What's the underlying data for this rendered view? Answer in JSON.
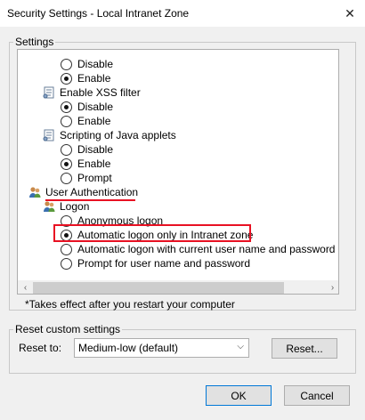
{
  "window": {
    "title": "Security Settings - Local Intranet Zone"
  },
  "settings_group": {
    "legend": "Settings"
  },
  "tree": [
    {
      "kind": "radio",
      "label": "Disable",
      "checked": false
    },
    {
      "kind": "radio",
      "label": "Enable",
      "checked": true
    },
    {
      "kind": "category",
      "label": "Enable XSS filter",
      "icon": "settings-page-icon"
    },
    {
      "kind": "radio",
      "label": "Disable",
      "checked": true
    },
    {
      "kind": "radio",
      "label": "Enable",
      "checked": false
    },
    {
      "kind": "category",
      "label": "Scripting of Java applets",
      "icon": "settings-page-icon"
    },
    {
      "kind": "radio",
      "label": "Disable",
      "checked": false
    },
    {
      "kind": "radio",
      "label": "Enable",
      "checked": true
    },
    {
      "kind": "radio",
      "label": "Prompt",
      "checked": false
    },
    {
      "kind": "category",
      "label": "User Authentication",
      "icon": "users-icon"
    },
    {
      "kind": "category",
      "label": "Logon",
      "icon": "users-icon"
    },
    {
      "kind": "radio",
      "label": "Anonymous logon",
      "checked": false
    },
    {
      "kind": "radio",
      "label": "Automatic logon only in Intranet zone",
      "checked": true
    },
    {
      "kind": "radio",
      "label": "Automatic logon with current user name and password",
      "checked": false
    },
    {
      "kind": "radio",
      "label": "Prompt for user name and password",
      "checked": false
    }
  ],
  "note": "*Takes effect after you restart your computer",
  "reset_group": {
    "legend": "Reset custom settings",
    "reset_to_label": "Reset to:",
    "selected_level": "Medium-low (default)",
    "reset_button": "Reset..."
  },
  "footer": {
    "ok": "OK",
    "cancel": "Cancel"
  },
  "colors": {
    "highlight": "#e81123",
    "window_bg": "#f0f0f0"
  }
}
